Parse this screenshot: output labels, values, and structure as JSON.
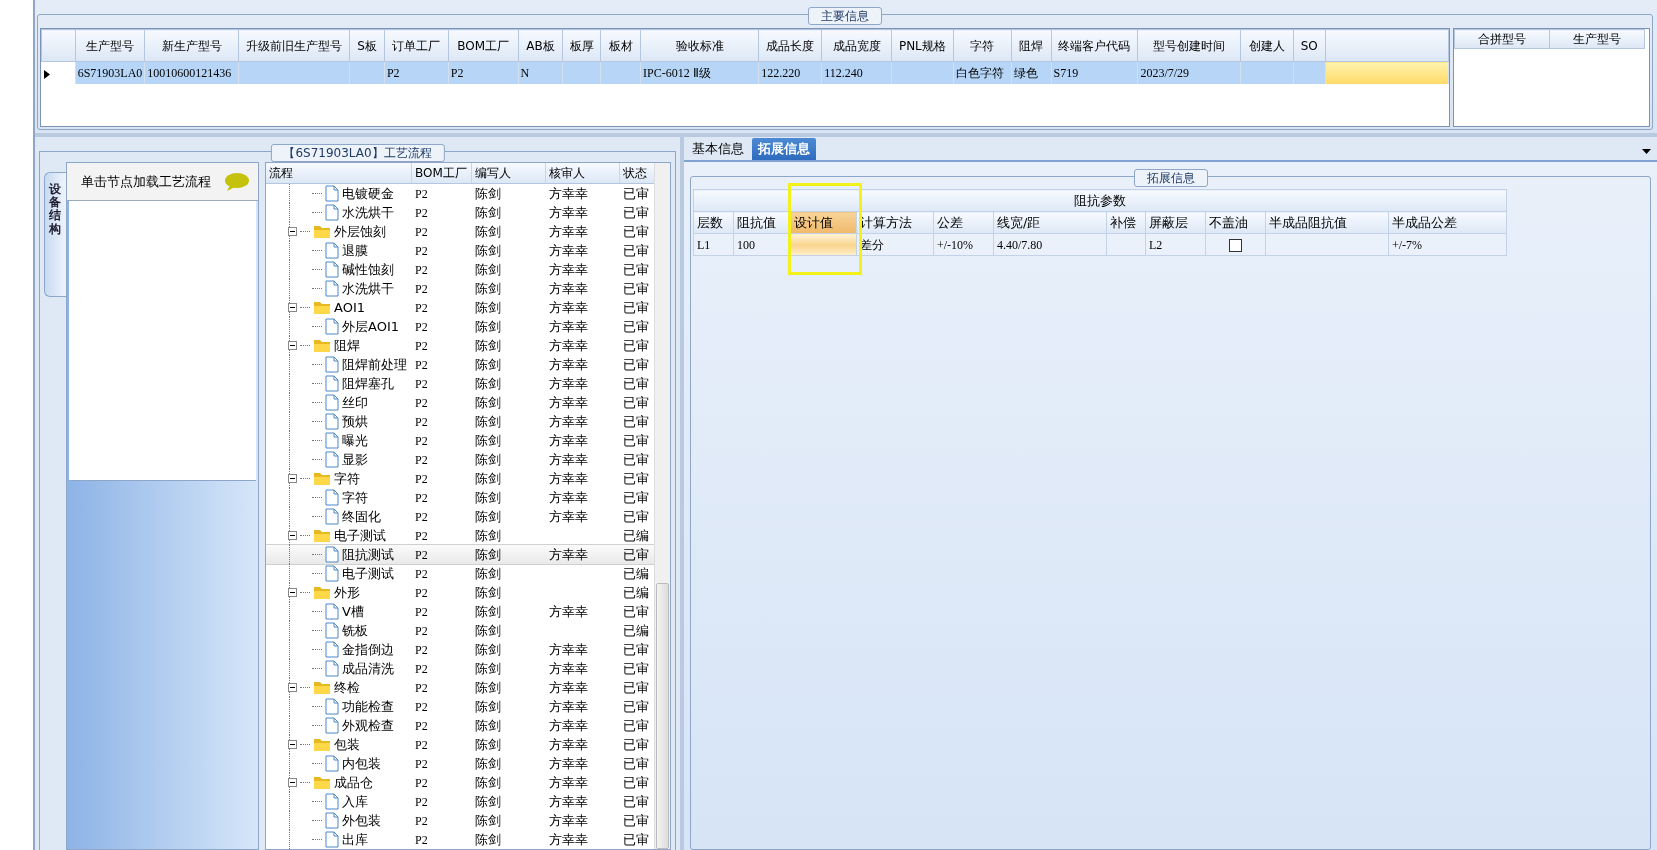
{
  "main_info": {
    "title": "主要信息",
    "columns": [
      "生产型号",
      "新生产型号",
      "升级前旧生产型号",
      "S板",
      "订单工厂",
      "BOM工厂",
      "AB板",
      "板厚",
      "板材",
      "验收标准",
      "成品长度",
      "成品宽度",
      "PNL规格",
      "字符",
      "阻焊",
      "终端客户代码",
      "型号创建时间",
      "创建人",
      "SO"
    ],
    "rows": [
      {
        "selected": true,
        "cells": [
          "6S71903LA0",
          "10010600121436",
          null,
          null,
          "P2",
          "P2",
          "N",
          null,
          null,
          "IPC-6012 Ⅱ级",
          "122.220",
          "112.240",
          null,
          "白色字符",
          "绿色",
          "S719",
          "2023/7/29",
          null,
          null
        ]
      }
    ]
  },
  "merge_grid": {
    "columns": [
      "合拼型号",
      "生产型号"
    ]
  },
  "process": {
    "title": "【6S71903LA0】工艺流程",
    "side_tab": "设备结构",
    "hint": "单击节点加载工艺流程",
    "columns": [
      "流程",
      "BOM工厂",
      "编写人",
      "核审人",
      "状态"
    ],
    "nodes": [
      {
        "kind": "file",
        "label": "电镀硬金",
        "bom": "P2",
        "writer": "陈剑",
        "reviewer": "方幸幸",
        "status": "已审",
        "selected": false
      },
      {
        "kind": "file",
        "label": "水洗烘干",
        "bom": "P2",
        "writer": "陈剑",
        "reviewer": "方幸幸",
        "status": "已审",
        "selected": false
      },
      {
        "kind": "folder",
        "label": "外层蚀刻",
        "bom": "P2",
        "writer": "陈剑",
        "reviewer": "方幸幸",
        "status": "已审",
        "selected": false,
        "expanded": true,
        "children": [
          {
            "kind": "file",
            "label": "退膜",
            "bom": "P2",
            "writer": "陈剑",
            "reviewer": "方幸幸",
            "status": "已审",
            "selected": false
          },
          {
            "kind": "file",
            "label": "碱性蚀刻",
            "bom": "P2",
            "writer": "陈剑",
            "reviewer": "方幸幸",
            "status": "已审",
            "selected": false
          },
          {
            "kind": "file",
            "label": "水洗烘干",
            "bom": "P2",
            "writer": "陈剑",
            "reviewer": "方幸幸",
            "status": "已审",
            "selected": false
          }
        ]
      },
      {
        "kind": "folder",
        "label": "AOI1",
        "bom": "P2",
        "writer": "陈剑",
        "reviewer": "方幸幸",
        "status": "已审",
        "selected": false,
        "expanded": true,
        "children": [
          {
            "kind": "file",
            "label": "外层AOI1",
            "bom": "P2",
            "writer": "陈剑",
            "reviewer": "方幸幸",
            "status": "已审",
            "selected": false
          }
        ]
      },
      {
        "kind": "folder",
        "label": "阻焊",
        "bom": "P2",
        "writer": "陈剑",
        "reviewer": "方幸幸",
        "status": "已审",
        "selected": false,
        "expanded": true,
        "children": [
          {
            "kind": "file",
            "label": "阻焊前处理",
            "bom": "P2",
            "writer": "陈剑",
            "reviewer": "方幸幸",
            "status": "已审",
            "selected": false
          },
          {
            "kind": "file",
            "label": "阻焊塞孔",
            "bom": "P2",
            "writer": "陈剑",
            "reviewer": "方幸幸",
            "status": "已审",
            "selected": false
          },
          {
            "kind": "file",
            "label": "丝印",
            "bom": "P2",
            "writer": "陈剑",
            "reviewer": "方幸幸",
            "status": "已审",
            "selected": false
          },
          {
            "kind": "file",
            "label": "预烘",
            "bom": "P2",
            "writer": "陈剑",
            "reviewer": "方幸幸",
            "status": "已审",
            "selected": false
          },
          {
            "kind": "file",
            "label": "曝光",
            "bom": "P2",
            "writer": "陈剑",
            "reviewer": "方幸幸",
            "status": "已审",
            "selected": false
          },
          {
            "kind": "file",
            "label": "显影",
            "bom": "P2",
            "writer": "陈剑",
            "reviewer": "方幸幸",
            "status": "已审",
            "selected": false
          }
        ]
      },
      {
        "kind": "folder",
        "label": "字符",
        "bom": "P2",
        "writer": "陈剑",
        "reviewer": "方幸幸",
        "status": "已审",
        "selected": false,
        "expanded": true,
        "children": [
          {
            "kind": "file",
            "label": "字符",
            "bom": "P2",
            "writer": "陈剑",
            "reviewer": "方幸幸",
            "status": "已审",
            "selected": false
          },
          {
            "kind": "file",
            "label": "终固化",
            "bom": "P2",
            "writer": "陈剑",
            "reviewer": "方幸幸",
            "status": "已审",
            "selected": false
          }
        ]
      },
      {
        "kind": "folder",
        "label": "电子测试",
        "bom": "P2",
        "writer": "陈剑",
        "status": "已编",
        "selected": false,
        "expanded": true,
        "children": [
          {
            "kind": "file",
            "label": "阻抗测试",
            "bom": "P2",
            "writer": "陈剑",
            "reviewer": "方幸幸",
            "status": "已审",
            "selected": true
          },
          {
            "kind": "file",
            "label": "电子测试",
            "bom": "P2",
            "writer": "陈剑",
            "status": "已编",
            "selected": false
          }
        ]
      },
      {
        "kind": "folder",
        "label": "外形",
        "bom": "P2",
        "writer": "陈剑",
        "status": "已编",
        "selected": false,
        "expanded": true,
        "children": [
          {
            "kind": "file",
            "label": "V槽",
            "bom": "P2",
            "writer": "陈剑",
            "reviewer": "方幸幸",
            "status": "已审",
            "selected": false
          },
          {
            "kind": "file",
            "label": "铣板",
            "bom": "P2",
            "writer": "陈剑",
            "status": "已编",
            "selected": false
          },
          {
            "kind": "file",
            "label": "金指倒边",
            "bom": "P2",
            "writer": "陈剑",
            "reviewer": "方幸幸",
            "status": "已审",
            "selected": false
          },
          {
            "kind": "file",
            "label": "成品清洗",
            "bom": "P2",
            "writer": "陈剑",
            "reviewer": "方幸幸",
            "status": "已审",
            "selected": false
          }
        ]
      },
      {
        "kind": "folder",
        "label": "终检",
        "bom": "P2",
        "writer": "陈剑",
        "reviewer": "方幸幸",
        "status": "已审",
        "selected": false,
        "expanded": true,
        "children": [
          {
            "kind": "file",
            "label": "功能检查",
            "bom": "P2",
            "writer": "陈剑",
            "reviewer": "方幸幸",
            "status": "已审",
            "selected": false
          },
          {
            "kind": "file",
            "label": "外观检查",
            "bom": "P2",
            "writer": "陈剑",
            "reviewer": "方幸幸",
            "status": "已审",
            "selected": false
          }
        ]
      },
      {
        "kind": "folder",
        "label": "包装",
        "bom": "P2",
        "writer": "陈剑",
        "reviewer": "方幸幸",
        "status": "已审",
        "selected": false,
        "expanded": true,
        "children": [
          {
            "kind": "file",
            "label": "内包装",
            "bom": "P2",
            "writer": "陈剑",
            "reviewer": "方幸幸",
            "status": "已审",
            "selected": false
          }
        ]
      },
      {
        "kind": "folder",
        "label": "成品仓",
        "bom": "P2",
        "writer": "陈剑",
        "reviewer": "方幸幸",
        "status": "已审",
        "selected": false,
        "expanded": true,
        "children": [
          {
            "kind": "file",
            "label": "入库",
            "bom": "P2",
            "writer": "陈剑",
            "reviewer": "方幸幸",
            "status": "已审",
            "selected": false
          },
          {
            "kind": "file",
            "label": "外包装",
            "bom": "P2",
            "writer": "陈剑",
            "reviewer": "方幸幸",
            "status": "已审",
            "selected": false
          },
          {
            "kind": "file",
            "label": "出库",
            "bom": "P2",
            "writer": "陈剑",
            "reviewer": "方幸幸",
            "status": "已审",
            "selected": false
          }
        ]
      }
    ]
  },
  "detail": {
    "tabs": [
      {
        "label": "基本信息",
        "selected": false
      },
      {
        "label": "拓展信息",
        "selected": true
      }
    ],
    "group_title": "拓展信息",
    "table": {
      "caption": "阻抗参数",
      "columns": [
        {
          "label": "层数",
          "highlighted": false
        },
        {
          "label": "阻抗值",
          "highlighted": false
        },
        {
          "label": "设计值",
          "highlighted": true
        },
        {
          "label": "计算方法",
          "highlighted": false
        },
        {
          "label": "公差",
          "highlighted": false
        },
        {
          "label": "线宽/距",
          "highlighted": false
        },
        {
          "label": "补偿",
          "highlighted": false
        },
        {
          "label": "屏蔽层",
          "highlighted": false
        },
        {
          "label": "不盖油",
          "highlighted": false,
          "kind": "checkbox"
        },
        {
          "label": "半成品阻抗值",
          "highlighted": false
        },
        {
          "label": "半成品公差",
          "highlighted": false
        }
      ],
      "rows": [
        {
          "cells": [
            "L1",
            "100",
            null,
            "差分",
            "+/-10%",
            "4.40/7.80",
            null,
            "L2",
            null,
            null,
            "+/-7%"
          ],
          "checked": false
        }
      ]
    }
  }
}
